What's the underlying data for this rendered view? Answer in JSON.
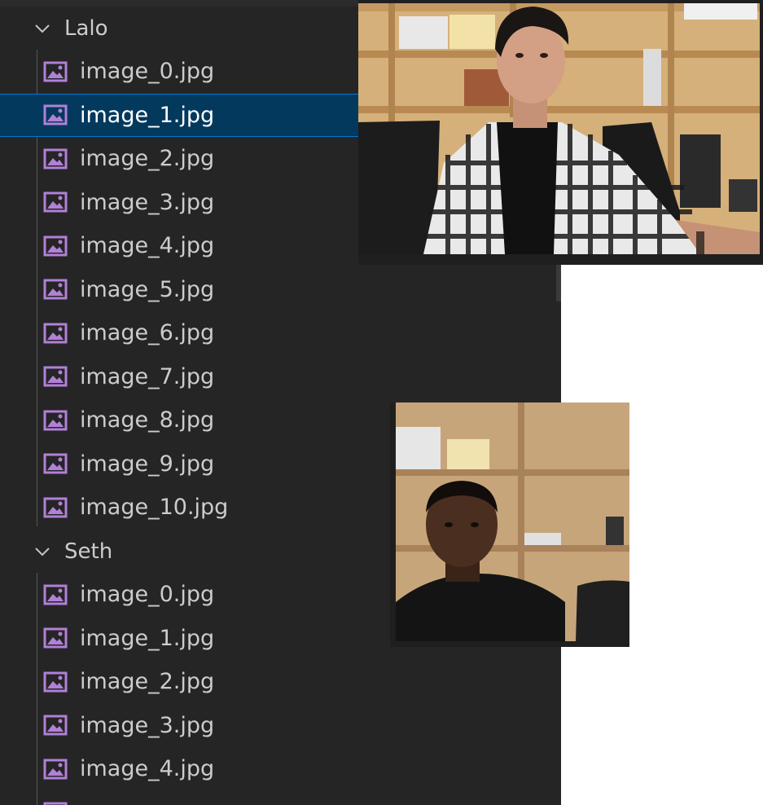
{
  "explorer": {
    "folders": [
      {
        "name": "Lalo",
        "expanded": true,
        "files": [
          "image_0.jpg",
          "image_1.jpg",
          "image_2.jpg",
          "image_3.jpg",
          "image_4.jpg",
          "image_5.jpg",
          "image_6.jpg",
          "image_7.jpg",
          "image_8.jpg",
          "image_9.jpg",
          "image_10.jpg"
        ],
        "selected_index": 1
      },
      {
        "name": "Seth",
        "expanded": true,
        "files": [
          "image_0.jpg",
          "image_1.jpg",
          "image_2.jpg",
          "image_3.jpg",
          "image_4.jpg"
        ]
      }
    ],
    "icons": {
      "folder_expanded": "chevron-down-icon",
      "file": "image-file-icon"
    },
    "colors": {
      "background": "#252526",
      "selection": "#04395e",
      "selection_border": "#0078d4",
      "text": "#cccccc",
      "image_icon": "#b180d7"
    }
  },
  "previews": [
    {
      "subject": "Man in plaid shirt seated at desk in front of wooden shelves"
    },
    {
      "subject": "Man in black t-shirt in front of wooden shelves"
    }
  ]
}
